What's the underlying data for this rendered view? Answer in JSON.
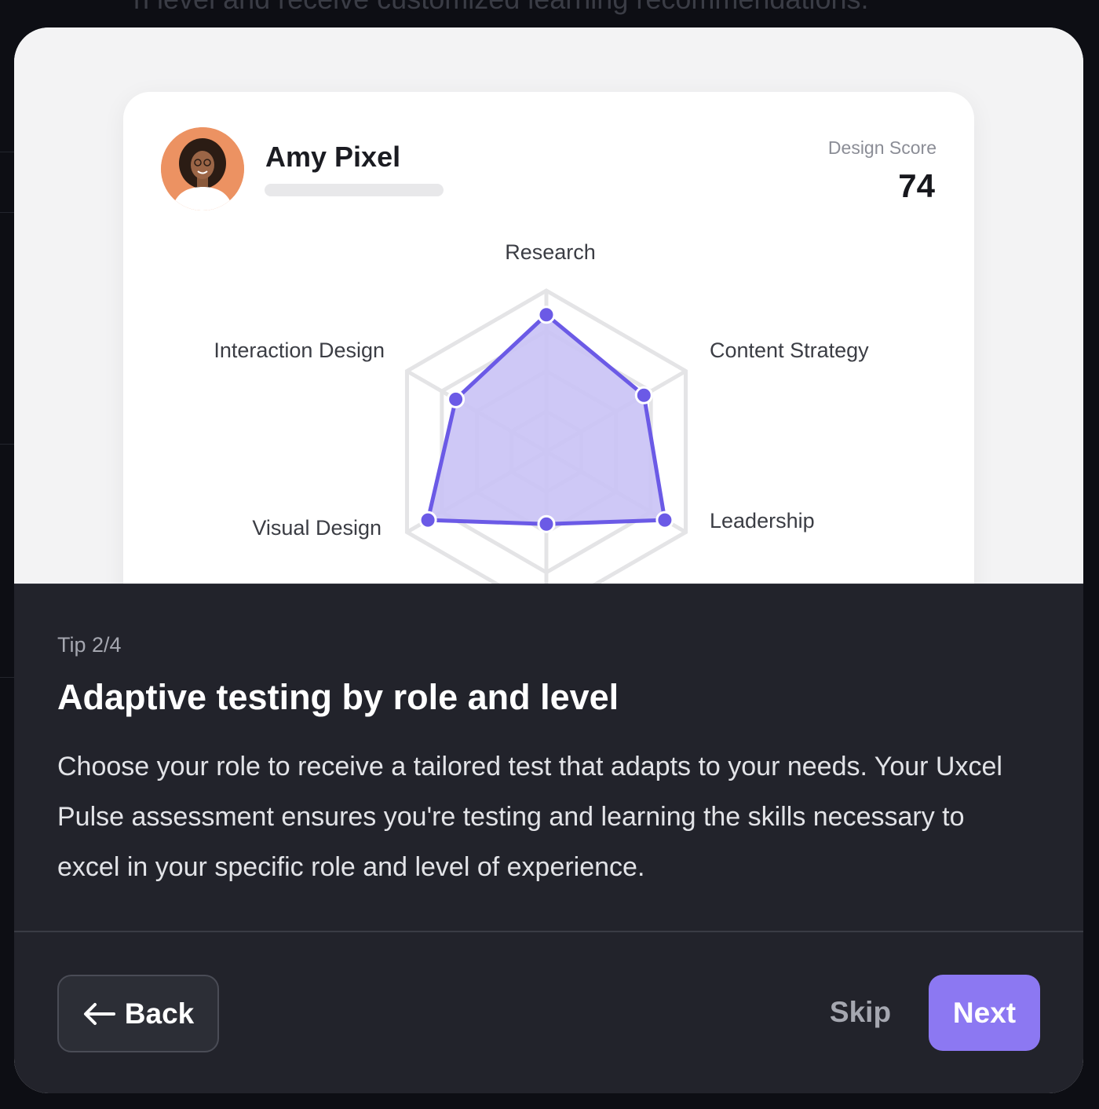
{
  "background": {
    "top_text": "n level and receive customized learning recommendations."
  },
  "profile": {
    "name": "Amy Pixel",
    "score_label": "Design Score",
    "score_value": "74"
  },
  "chart_data": {
    "type": "radar",
    "axes": [
      "Research",
      "Content Strategy",
      "Leadership",
      "",
      "Visual Design",
      "Interaction Design"
    ],
    "values": [
      0.85,
      0.7,
      0.85,
      0.45,
      0.85,
      0.65
    ],
    "rings": 4,
    "max": 1,
    "series_color": "#6b5ae6",
    "fill_color": "#c9c2f5"
  },
  "tip": {
    "step": "Tip 2/4",
    "title": "Adaptive testing by role and level",
    "body": "Choose your role to receive a tailored test that adapts to your needs. Your Uxcel Pulse assessment ensures you're testing and learning the skills necessary to excel in your specific role and level of experience."
  },
  "buttons": {
    "back": "Back",
    "skip": "Skip",
    "next": "Next"
  },
  "colors": {
    "accent": "#8c78f2",
    "panel": "#22232b"
  }
}
